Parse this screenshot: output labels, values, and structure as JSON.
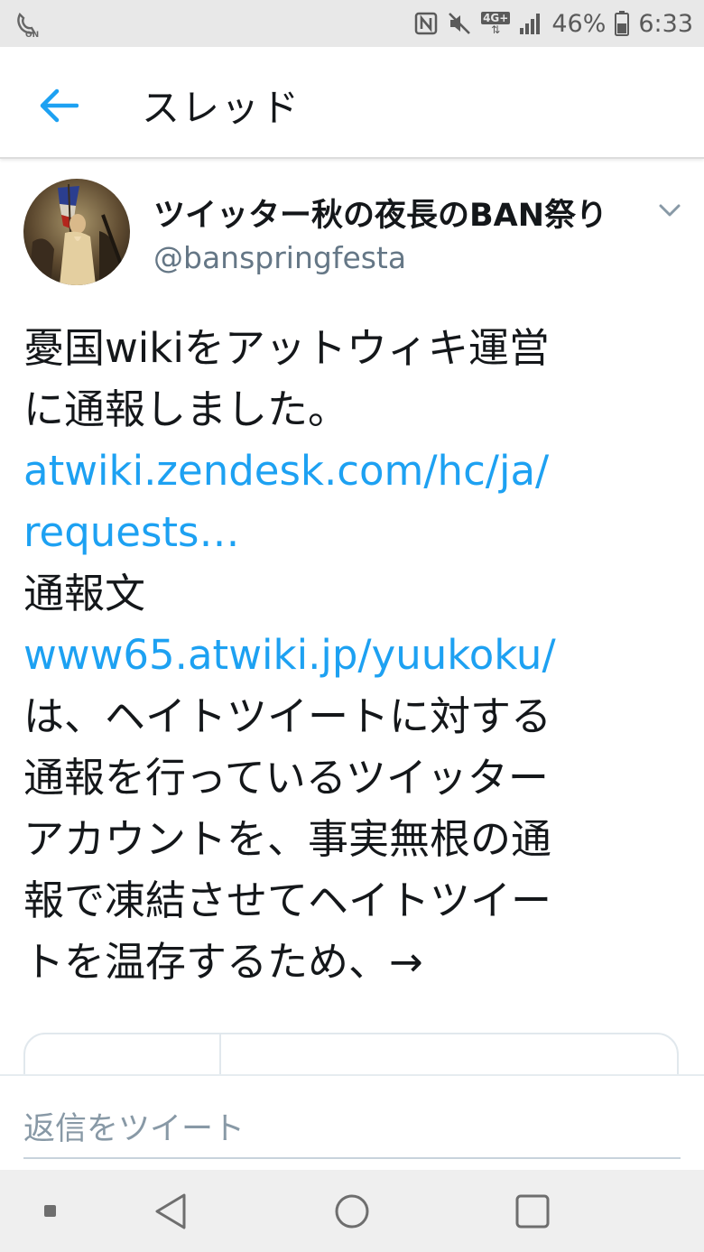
{
  "status_bar": {
    "battery_percent": "46%",
    "time": "6:33",
    "network": "4G+",
    "icons": [
      "volte-icon",
      "nfc-icon",
      "mute-icon",
      "signal-icon",
      "battery-icon"
    ]
  },
  "header": {
    "title": "スレッド",
    "back_icon": "back-arrow-icon"
  },
  "tweet": {
    "display_name": "ツイッター秋の夜長のBAN祭り",
    "handle": "@banspringfesta",
    "body_lines": [
      {
        "text": "憂国wikiをアットウィキ運営",
        "link": false
      },
      {
        "text": "に通報しました。",
        "link": false
      },
      {
        "text": "atwiki.zendesk.com/hc/ja/",
        "link": true
      },
      {
        "text": "requests…",
        "link": true
      },
      {
        "text": "通報文",
        "link": false
      },
      {
        "text": "www65.atwiki.jp/yuukoku/",
        "link": true
      },
      {
        "text": "は、ヘイトツイートに対する",
        "link": false
      },
      {
        "text": "通報を行っているツイッター",
        "link": false
      },
      {
        "text": "アカウントを、事実無根の通",
        "link": false
      },
      {
        "text": "報で凍結させてヘイトツイー",
        "link": false
      },
      {
        "text": "トを温存するため、→",
        "link": false
      }
    ],
    "menu_icon": "chevron-down-icon"
  },
  "reply": {
    "placeholder": "返信をツイート"
  },
  "colors": {
    "link": "#1da1f2",
    "text": "#14171a",
    "secondary": "#657786"
  }
}
